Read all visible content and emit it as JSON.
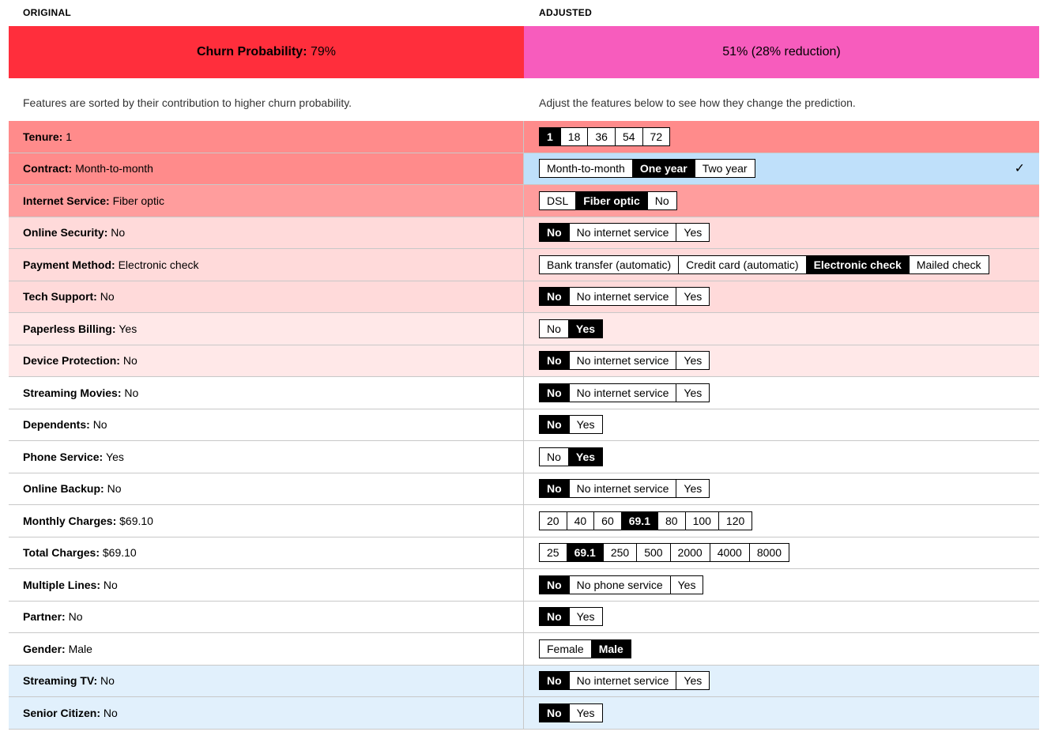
{
  "headers": {
    "original": "ORIGINAL",
    "adjusted": "ADJUSTED"
  },
  "banner": {
    "original_label": "Churn Probability:",
    "original_value": "79%",
    "adjusted_text": "51% (28% reduction)",
    "colors": {
      "original": "#ff2e3c",
      "adjusted": "#f75cbd"
    }
  },
  "subtitles": {
    "original": "Features are sorted by their contribution to higher churn probability.",
    "adjusted": "Adjust the features below to see how they change the prediction."
  },
  "features": [
    {
      "label": "Tenure:",
      "value": "1",
      "level": "lvl1",
      "options": [
        "1",
        "18",
        "36",
        "54",
        "72"
      ],
      "selected": 0
    },
    {
      "label": "Contract:",
      "value": "Month-to-month",
      "level": "lvl1",
      "options": [
        "Month-to-month",
        "One year",
        "Two year"
      ],
      "selected": 1,
      "changed": true,
      "check": "✓"
    },
    {
      "label": "Internet Service:",
      "value": "Fiber optic",
      "level": "lvl2",
      "options": [
        "DSL",
        "Fiber optic",
        "No"
      ],
      "selected": 1
    },
    {
      "label": "Online Security:",
      "value": "No",
      "level": "lvl3",
      "options": [
        "No",
        "No internet service",
        "Yes"
      ],
      "selected": 0
    },
    {
      "label": "Payment Method:",
      "value": "Electronic check",
      "level": "lvl3",
      "options": [
        "Bank transfer (automatic)",
        "Credit card (automatic)",
        "Electronic check",
        "Mailed check"
      ],
      "selected": 2
    },
    {
      "label": "Tech Support:",
      "value": "No",
      "level": "lvl3",
      "options": [
        "No",
        "No internet service",
        "Yes"
      ],
      "selected": 0
    },
    {
      "label": "Paperless Billing:",
      "value": "Yes",
      "level": "lvl4",
      "options": [
        "No",
        "Yes"
      ],
      "selected": 1
    },
    {
      "label": "Device Protection:",
      "value": "No",
      "level": "lvl4",
      "options": [
        "No",
        "No internet service",
        "Yes"
      ],
      "selected": 0
    },
    {
      "label": "Streaming Movies:",
      "value": "No",
      "level": "lvl5",
      "options": [
        "No",
        "No internet service",
        "Yes"
      ],
      "selected": 0
    },
    {
      "label": "Dependents:",
      "value": "No",
      "level": "lvl5",
      "options": [
        "No",
        "Yes"
      ],
      "selected": 0
    },
    {
      "label": "Phone Service:",
      "value": "Yes",
      "level": "lvl5",
      "options": [
        "No",
        "Yes"
      ],
      "selected": 1
    },
    {
      "label": "Online Backup:",
      "value": "No",
      "level": "lvl5",
      "options": [
        "No",
        "No internet service",
        "Yes"
      ],
      "selected": 0
    },
    {
      "label": "Monthly Charges:",
      "value": "$69.10",
      "level": "lvl5",
      "options": [
        "20",
        "40",
        "60",
        "69.1",
        "80",
        "100",
        "120"
      ],
      "selected": 3
    },
    {
      "label": "Total Charges:",
      "value": "$69.10",
      "level": "lvl5",
      "options": [
        "25",
        "69.1",
        "250",
        "500",
        "2000",
        "4000",
        "8000"
      ],
      "selected": 1
    },
    {
      "label": "Multiple Lines:",
      "value": "No",
      "level": "lvl5",
      "options": [
        "No",
        "No phone service",
        "Yes"
      ],
      "selected": 0
    },
    {
      "label": "Partner:",
      "value": "No",
      "level": "lvl5",
      "options": [
        "No",
        "Yes"
      ],
      "selected": 0
    },
    {
      "label": "Gender:",
      "value": "Male",
      "level": "lvl5",
      "options": [
        "Female",
        "Male"
      ],
      "selected": 1
    },
    {
      "label": "Streaming TV:",
      "value": "No",
      "level": "lvl6",
      "options": [
        "No",
        "No internet service",
        "Yes"
      ],
      "selected": 0
    },
    {
      "label": "Senior Citizen:",
      "value": "No",
      "level": "lvl6",
      "options": [
        "No",
        "Yes"
      ],
      "selected": 0
    }
  ]
}
